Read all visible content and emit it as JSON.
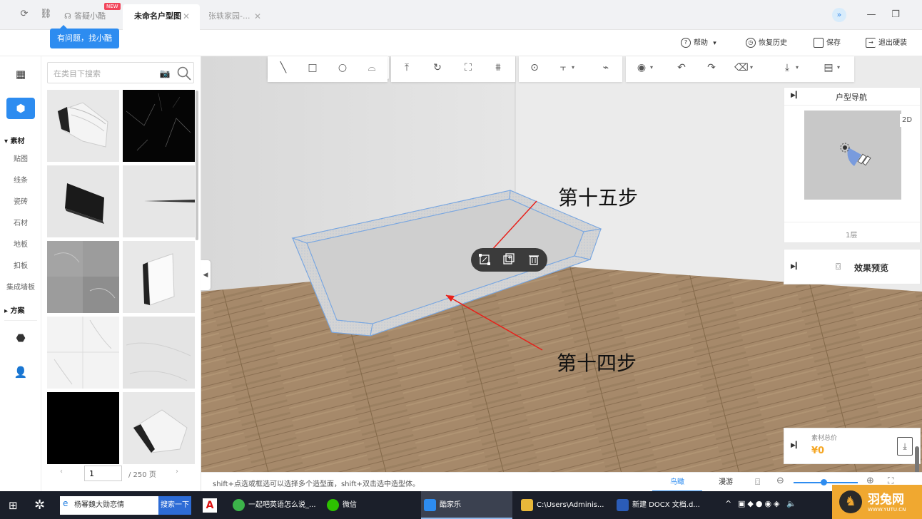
{
  "tabs": {
    "help_tab": "答疑小酷",
    "help_badge": "NEW",
    "active_tab": "未命名户型图",
    "other_tab": "张轶家园-..."
  },
  "tooltip": "有问题，找小酷",
  "header": {
    "help": "帮助",
    "history": "恢复历史",
    "save": "保存",
    "exit": "退出硬装"
  },
  "rail": {
    "cat_material": "▾ 素材",
    "items": [
      "贴图",
      "线条",
      "瓷砖",
      "石材",
      "地板",
      "扣板",
      "集成墙板"
    ],
    "cat_plan": "▸ 方案"
  },
  "search": {
    "placeholder": "在类目下搜索"
  },
  "pager": {
    "current": "1",
    "total": "/ 250 页"
  },
  "annotations": {
    "step15": "第十五步",
    "step14": "第十四步"
  },
  "nav_panel": {
    "title": "户型导航",
    "mode": "2D",
    "floor": "1层"
  },
  "preview_panel": {
    "title": "效果预览"
  },
  "price_panel": {
    "label": "素材总价",
    "value": "¥0"
  },
  "status": {
    "hint": "shift+点选或框选可以选择多个造型面，shift+双击选中造型体。",
    "view_bird": "鸟瞰",
    "view_walk": "漫游"
  },
  "taskbar": {
    "search_text": "杨幂魏大勋恋情",
    "search_btn": "搜索一下",
    "items": [
      "一起吧英语怎么说_...",
      "微信",
      "酷家乐",
      "C:\\Users\\Adminis...",
      "新建 DOCX 文档.d..."
    ]
  },
  "watermark": {
    "name": "羽兔网",
    "url": "WWW.YUTU.CN"
  },
  "colors": {
    "accent": "#2d8cf0",
    "price": "#f5a623",
    "annotation_arrow": "#e8201a"
  }
}
